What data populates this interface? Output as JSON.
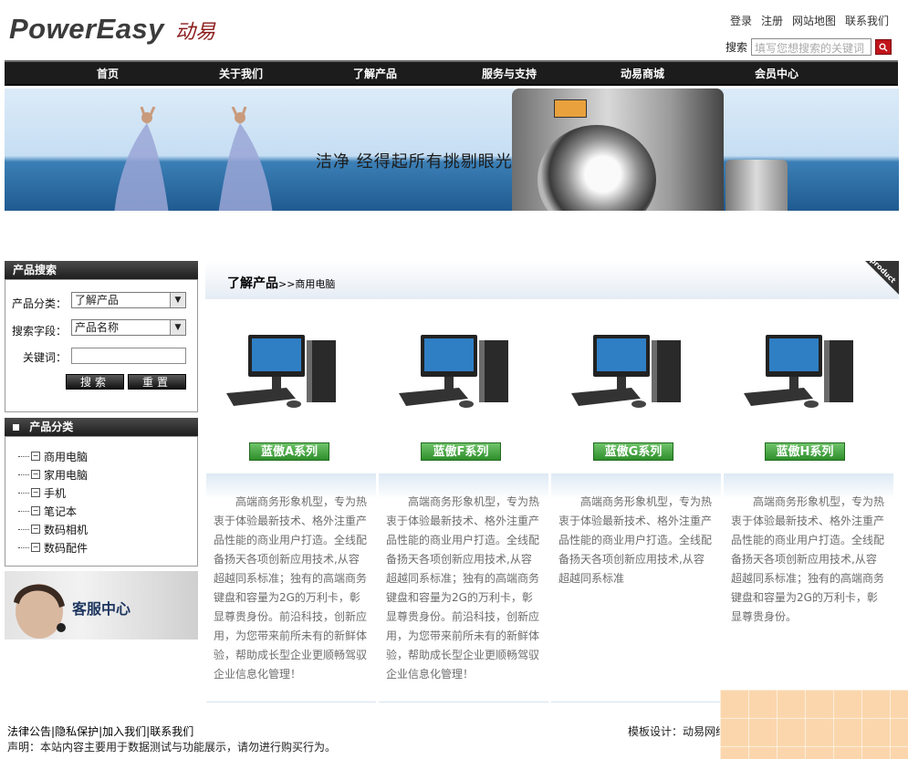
{
  "header": {
    "logo_text": "PowerEasy",
    "logo_cn": "动易",
    "top_links": [
      "登录",
      "注册",
      "网站地图",
      "联系我们"
    ],
    "search_label": "搜索",
    "search_placeholder": "填写您想搜索的关键词"
  },
  "nav": [
    "首页",
    "关于我们",
    "了解产品",
    "服务与支持",
    "动易商城",
    "会员中心"
  ],
  "banner": {
    "slogan": "洁净 经得起所有挑剔眼光"
  },
  "product_search": {
    "title": "产品搜索",
    "category_label": "产品分类：",
    "category_value": "了解产品",
    "field_label": "搜索字段：",
    "field_value": "产品名称",
    "keyword_label": "关键词：",
    "search_button": "搜索",
    "reset_button": "重置"
  },
  "category_panel": {
    "title": "产品分类",
    "items": [
      "商用电脑",
      "家用电脑",
      "手机",
      "笔记本",
      "数码相机",
      "数码配件"
    ]
  },
  "service": {
    "label": "客服中心"
  },
  "main": {
    "title": "了解产品",
    "breadcrumb": ">>商用电脑",
    "corner_tag": "product",
    "products": [
      {
        "name": "蓝傲A系列",
        "desc": "高端商务形象机型，专为热衷于体验最新技术、格外注重产品性能的商业用户打造。全线配备扬天各项创新应用技术,从容超越同系标准；独有的高端商务键盘和容量为2G的万利卡，彰显尊贵身份。前沿科技，创新应用，为您带来前所未有的新鲜体验，帮助成长型企业更顺畅驾驭企业信息化管理！"
      },
      {
        "name": "蓝傲F系列",
        "desc": "高端商务形象机型，专为热衷于体验最新技术、格外注重产品性能的商业用户打造。全线配备扬天各项创新应用技术,从容超越同系标准；独有的高端商务键盘和容量为2G的万利卡，彰显尊贵身份。前沿科技，创新应用，为您带来前所未有的新鲜体验，帮助成长型企业更顺畅驾驭企业信息化管理！"
      },
      {
        "name": "蓝傲G系列",
        "desc": "高端商务形象机型，专为热衷于体验最新技术、格外注重产品性能的商业用户打造。全线配备扬天各项创新应用技术,从容超越同系标准"
      },
      {
        "name": "蓝傲H系列",
        "desc": "高端商务形象机型，专为热衷于体验最新技术、格外注重产品性能的商业用户打造。全线配备扬天各项创新应用技术,从容超越同系标准；独有的高端商务键盘和容量为2G的万利卡，彰显尊贵身份。"
      }
    ]
  },
  "footer": {
    "links": [
      "法律公告",
      "隐私保护",
      "加入我们",
      "联系我们"
    ],
    "note": "声明：本站内容主要用于数据测试与功能展示，请勿进行购买行为。",
    "design": "模板设计：动易网络"
  }
}
